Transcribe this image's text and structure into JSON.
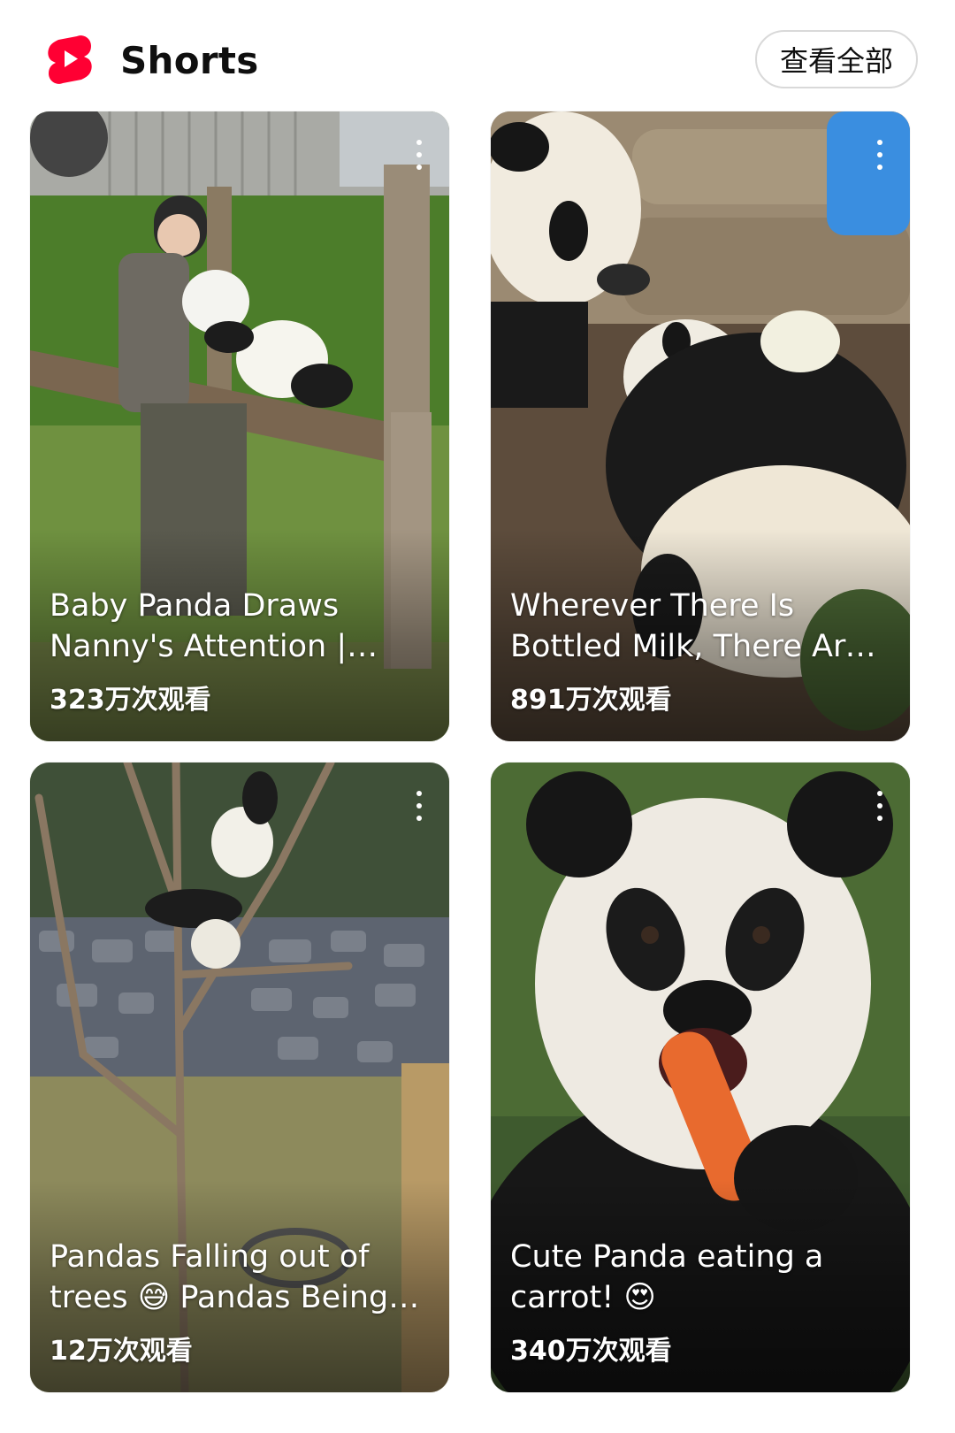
{
  "header": {
    "title": "Shorts",
    "view_all_label": "查看全部",
    "brand_color": "#ff0033"
  },
  "shorts": [
    {
      "title": "Baby Panda Draws Nanny's Attention | iPanda Panda Diary Extra",
      "views": "323万次观看"
    },
    {
      "title": "Wherever There Is Bottled Milk, There Are Pandas",
      "views": "891万次观看"
    },
    {
      "title": "Pandas Falling out of trees 😅 Pandas Being Clumsy",
      "views": "12万次观看"
    },
    {
      "title": "Cute Panda eating a carrot! 😍",
      "views": "340万次观看"
    }
  ]
}
